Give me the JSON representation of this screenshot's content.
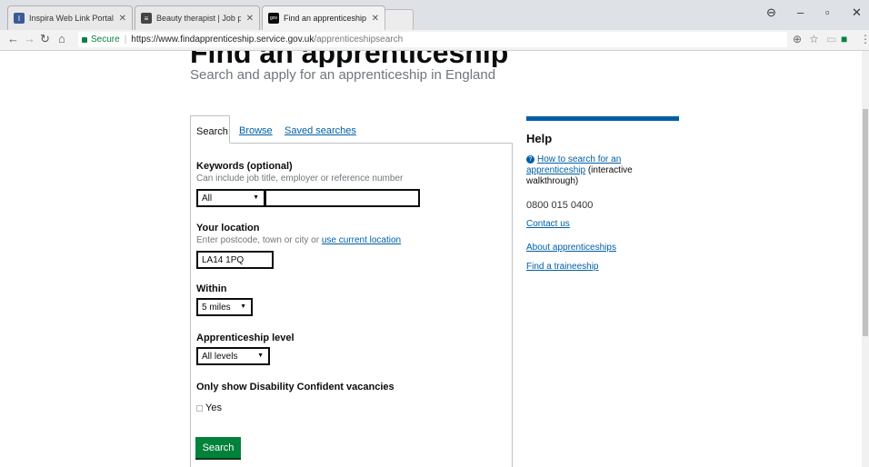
{
  "browser": {
    "tabs": [
      {
        "title": "Inspira Web Link Portal",
        "icon": "I"
      },
      {
        "title": "Beauty therapist | Job pr",
        "icon": "≡"
      },
      {
        "title": "Find an apprenticeship",
        "icon": "gov"
      }
    ],
    "secure_label": "Secure",
    "url_host": "https://www.findapprenticeship.service.gov.uk",
    "url_path": "/apprenticeshipsearch"
  },
  "page": {
    "title": "Find an apprenticeship",
    "subtitle": "Search and apply for an apprenticeship in England"
  },
  "tabs": {
    "search": "Search",
    "browse": "Browse",
    "saved": "Saved searches"
  },
  "form": {
    "keywords_label": "Keywords (optional)",
    "keywords_hint": "Can include job title, employer or reference number",
    "keywords_category": "All",
    "keywords_value": "",
    "location_label": "Your location",
    "location_hint": "Enter postcode, town or city or ",
    "location_link": "use current location",
    "location_value": "LA14 1PQ",
    "within_label": "Within",
    "within_value": "5 miles",
    "level_label": "Apprenticeship level",
    "level_value": "All levels",
    "disability_label": "Only show Disability Confident vacancies",
    "yes_label": "Yes",
    "search_button": "Search"
  },
  "help": {
    "heading": "Help",
    "how_link": "How to search for an apprenticeship",
    "how_suffix": " (interactive walkthrough)",
    "phone": "0800 015 0400",
    "contact": "Contact us",
    "about": "About apprenticeships",
    "traineeship": "Find a traineeship"
  },
  "colors": {
    "link": "#005ea5",
    "button": "#00823b",
    "text": "#0b0c0c"
  }
}
